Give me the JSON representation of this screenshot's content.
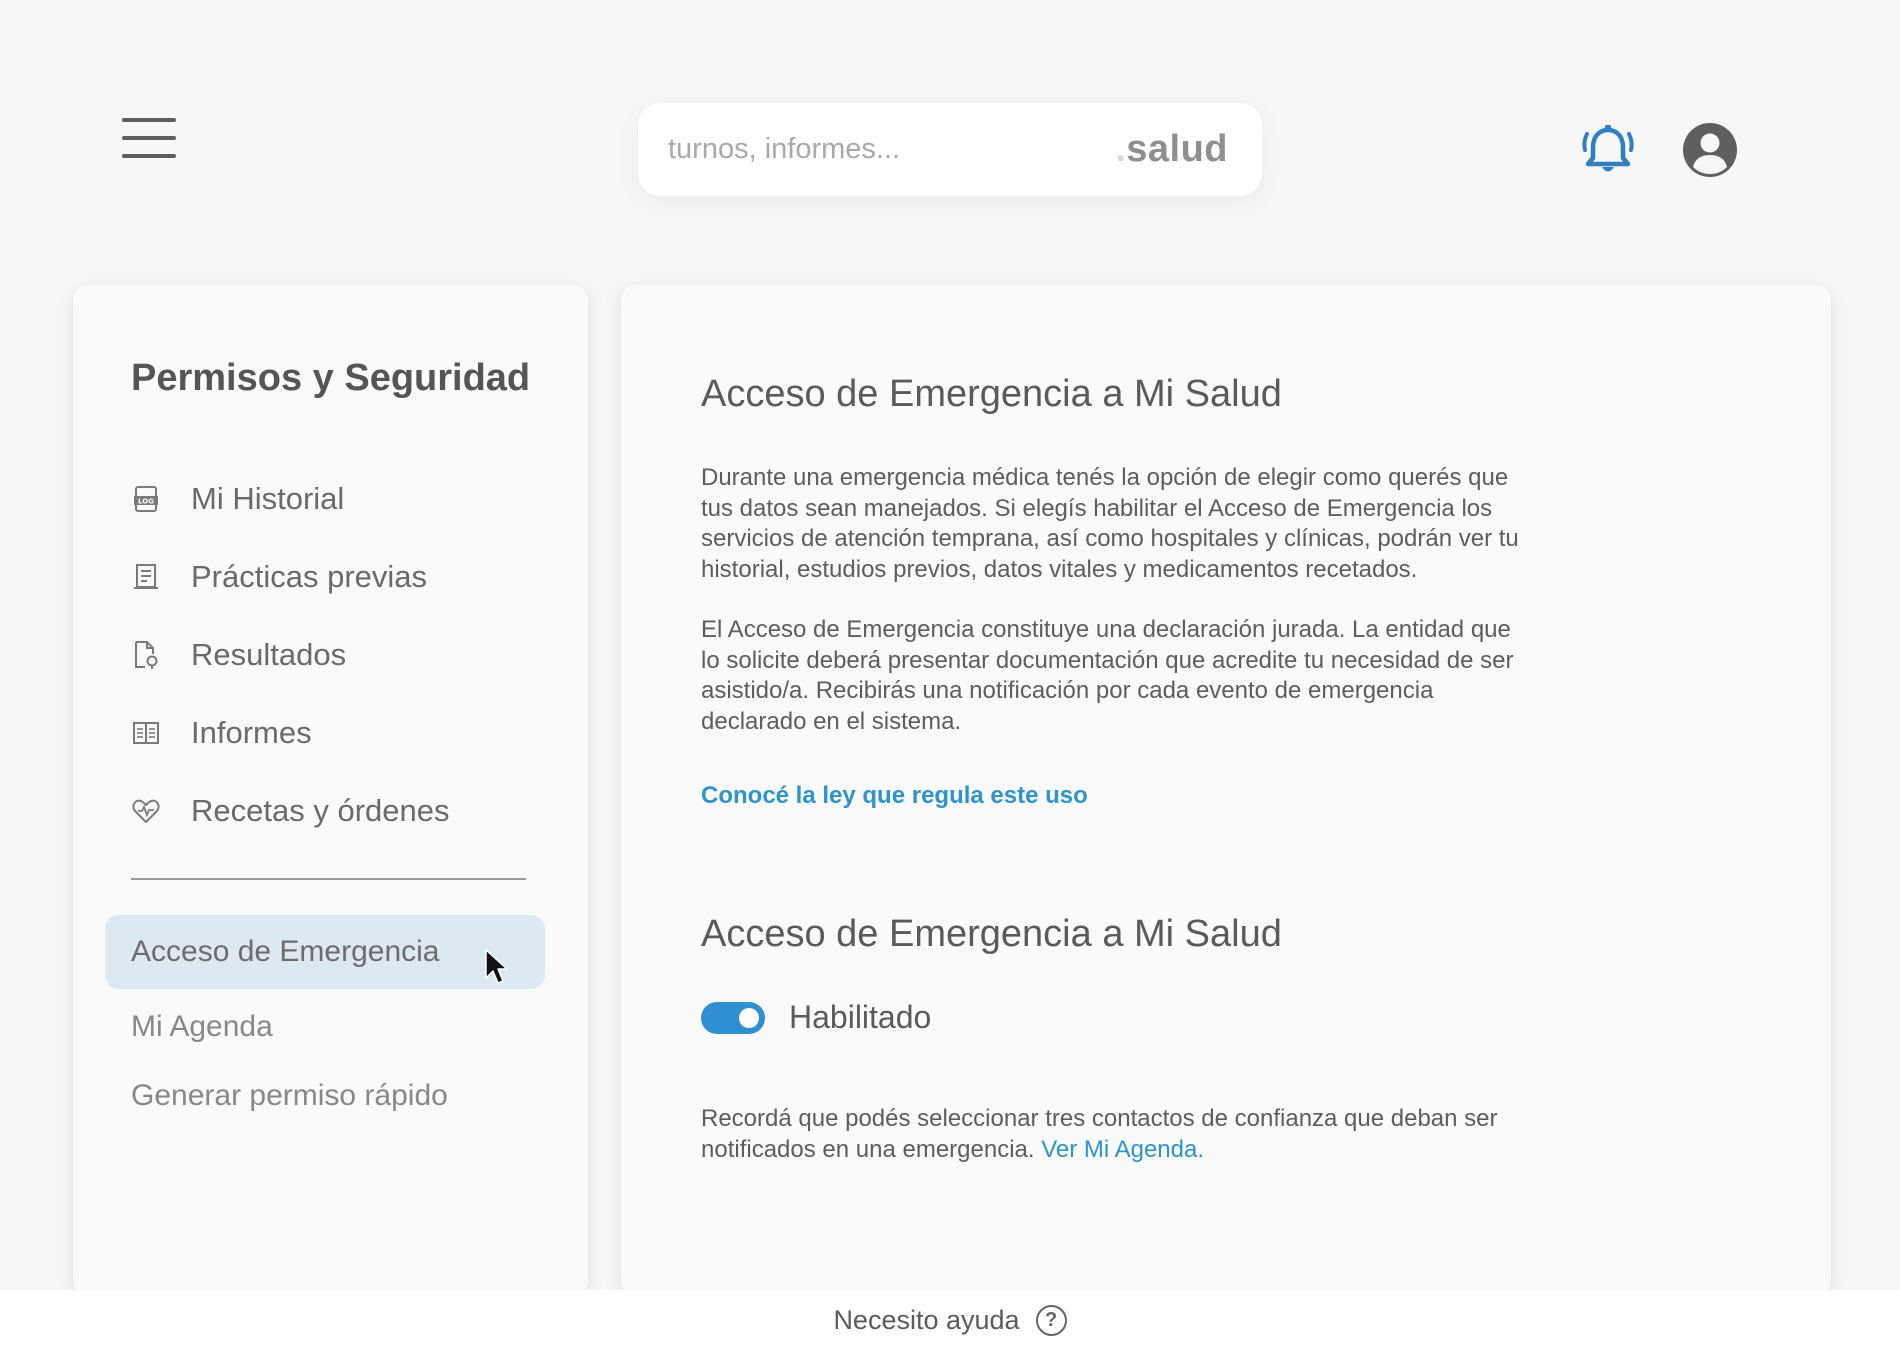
{
  "header": {
    "search_placeholder": "turnos, informes...",
    "brand_dot": ".",
    "brand_name": "salud",
    "menu_icon": "hamburger-menu-icon",
    "notification_icon": "bell-icon",
    "profile_icon": "user-avatar-icon",
    "accent_color": "#2f7fc1"
  },
  "sidebar": {
    "title": "Permisos y Seguridad",
    "items": [
      {
        "label": "Mi Historial",
        "icon": "log-document-icon"
      },
      {
        "label": "Prácticas previas",
        "icon": "list-document-icon"
      },
      {
        "label": "Resultados",
        "icon": "file-search-icon"
      },
      {
        "label": "Informes",
        "icon": "book-icon"
      },
      {
        "label": "Recetas y órdenes",
        "icon": "heart-pulse-icon"
      }
    ],
    "sub_items": [
      {
        "label": "Acceso de Emergencia",
        "active": true
      },
      {
        "label": "Mi Agenda",
        "active": false
      },
      {
        "label": "Generar permiso rápido",
        "active": false
      }
    ],
    "active_color": "#dde9f1"
  },
  "main": {
    "title": "Acceso de Emergencia a Mi Salud",
    "paragraph1": "Durante una emergencia médica tenés la opción de elegir como querés que tus datos sean manejados. Si elegís habilitar el Acceso de Emergencia los servicios de atención temprana, así como hospitales y clínicas, podrán ver tu historial, estudios previos, datos vitales y medicamentos recetados.",
    "paragraph2": "El Acceso de Emergencia constituye una declaración jurada. La entidad que lo solicite deberá presentar documentación que acredite tu necesidad de ser asistido/a. Recibirás una notificación por cada evento de emergencia declarado en el sistema.",
    "law_link": "Conocé la ley que regula este uso",
    "section_title": "Acceso de Emergencia a Mi Salud",
    "toggle_label": "Habilitado",
    "toggle_on": true,
    "note_text": "Recordá que podés seleccionar tres contactos de confianza que deban ser notificados en una emergencia.",
    "note_link": "Ver Mi Agenda.",
    "link_color": "#2d94cc"
  },
  "footer": {
    "help_label": "Necesito ayuda",
    "help_icon": "question-circle-icon"
  }
}
